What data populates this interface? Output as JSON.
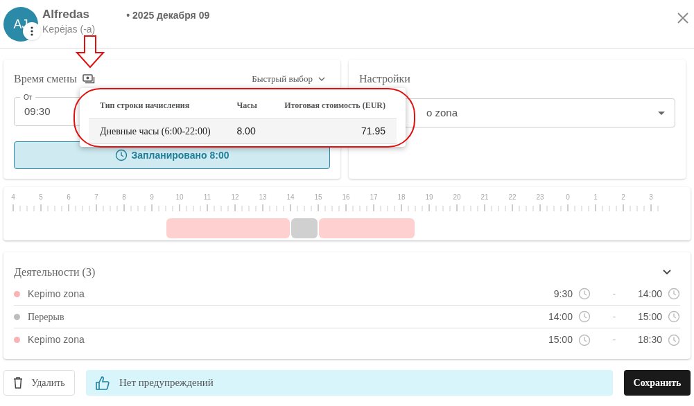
{
  "header": {
    "initials": "AJ",
    "name": "Alfredas",
    "role": "Kepėjas (-a)",
    "date": "• 2025 декабря 09"
  },
  "shift_card": {
    "title": "Время смены",
    "quick_select": "Быстрый выбор",
    "from_label": "От",
    "from_value": "09:30",
    "planned": "Запланировано 8:00"
  },
  "settings_card": {
    "title": "Настройки",
    "field_value": "o zona"
  },
  "popover": {
    "columns": [
      "Тип строки начисления",
      "Часы",
      "Итоговая стоимость (EUR)"
    ],
    "rows": [
      [
        "Дневные часы (6:00-22:00)",
        "8.00",
        "71.95"
      ]
    ]
  },
  "timeline": {
    "hours": [
      "4",
      "5",
      "6",
      "7",
      "8",
      "9",
      "10",
      "11",
      "12",
      "13",
      "14",
      "15",
      "16",
      "17",
      "18",
      "19",
      "20",
      "21",
      "22",
      "23",
      "0",
      "1",
      "2",
      "3"
    ]
  },
  "activities": {
    "title": "Деятельности (3)",
    "items": [
      {
        "name": "Kepimo zona",
        "color": "#f8b4b4",
        "start": "9:30",
        "separator": "-",
        "end": "14:00",
        "kind": "work"
      },
      {
        "name": "Перерыв",
        "color": "#bdbdbd",
        "start": "14:00",
        "separator": "-",
        "end": "15:00",
        "kind": "break"
      },
      {
        "name": "Kepimo zona",
        "color": "#f8b4b4",
        "start": "15:00",
        "separator": "-",
        "end": "18:30",
        "kind": "work"
      }
    ]
  },
  "footer": {
    "delete": "Удалить",
    "notice": "Нет предупреждений",
    "save": "Сохранить"
  }
}
